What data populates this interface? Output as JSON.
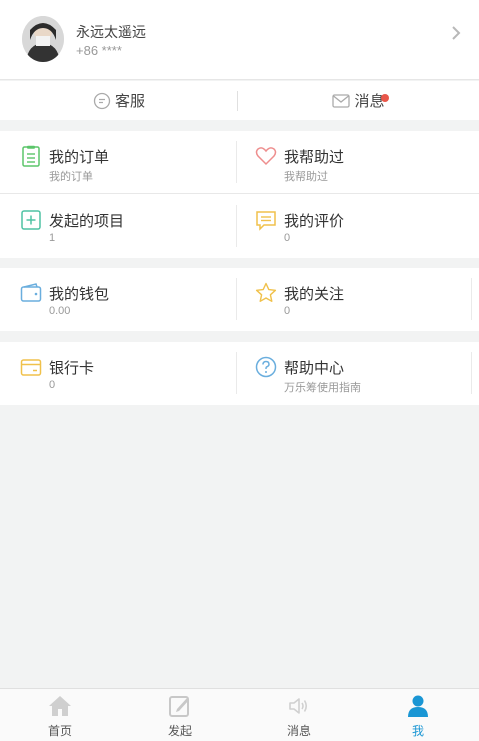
{
  "profile": {
    "name": "永远太遥远",
    "phone": "+86 ****"
  },
  "quick": {
    "service_label": "客服",
    "message_label": "消息"
  },
  "menu": {
    "orders": {
      "title": "我的订单",
      "sub": "我的订单"
    },
    "helped": {
      "title": "我帮助过",
      "sub": "我帮助过"
    },
    "projects": {
      "title": "发起的项目",
      "sub": "1"
    },
    "reviews": {
      "title": "我的评价",
      "sub": "0"
    },
    "wallet": {
      "title": "我的钱包",
      "sub": "0.00"
    },
    "follows": {
      "title": "我的关注",
      "sub": "0"
    },
    "bankcard": {
      "title": "银行卡",
      "sub": "0"
    },
    "help": {
      "title": "帮助中心",
      "sub": "万乐筹使用指南"
    }
  },
  "tabs": [
    {
      "label": "首页",
      "icon": "home-icon"
    },
    {
      "label": "发起",
      "icon": "edit-icon"
    },
    {
      "label": "消息",
      "icon": "speaker-icon"
    },
    {
      "label": "我",
      "icon": "user-icon"
    }
  ],
  "colors": {
    "accent": "#1a96d4",
    "badge": "#e8574a",
    "green": "#5bc56a",
    "pink": "#ee8e8e",
    "yellow": "#f0c14b",
    "teal": "#4fc2a4",
    "blue": "#6aaede"
  }
}
